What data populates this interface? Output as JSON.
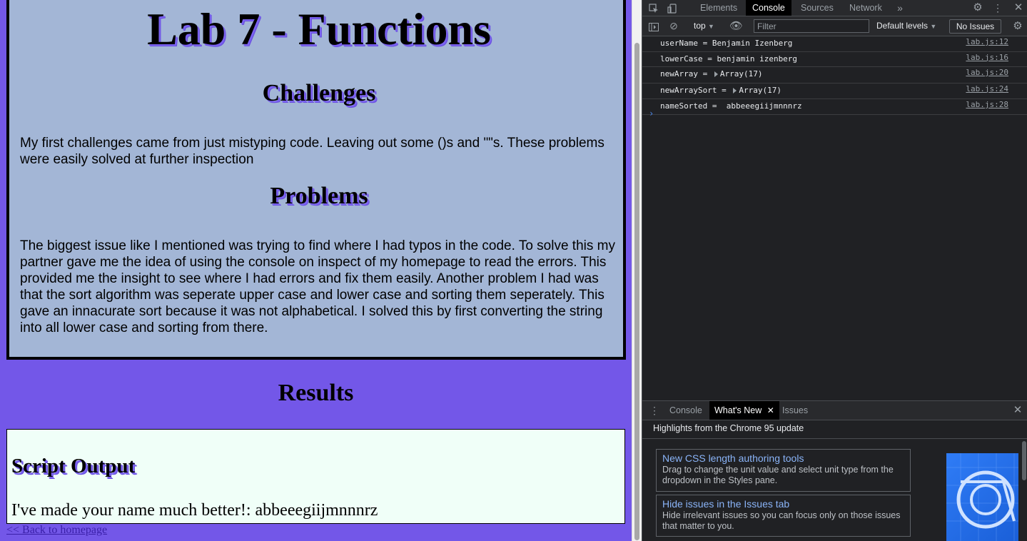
{
  "page": {
    "title": "Lab 7 - Functions",
    "challenges_heading": "Challenges",
    "challenges_text": "My first challenges came from just mistyping code. Leaving out some ()s and \"\"s. These problems were easily solved at further inspection",
    "problems_heading": "Problems",
    "problems_text": "The biggest issue like I mentioned was trying to find where I had typos in the code. To solve this my partner gave me the idea of using the console on inspect of my homepage to read the errors. This provided me the insight to see where I had errors and fix them easily. Another problem I had was that the sort algorithm was seperate upper case and lower case and sorting them seperately. This gave an innacurate sort because it was not alphabetical. I solved this by first converting the string into all lower case and sorting from there.",
    "results_heading": "Results",
    "output_heading": "Script Output",
    "output_text": "I've made your name much better!: abbeeegiijmnnnrz",
    "back_link": "<< Back to homepage"
  },
  "devtools": {
    "tabs": [
      "Elements",
      "Console",
      "Sources",
      "Network"
    ],
    "active_tab": "Console",
    "more_tabs": "»",
    "toolbar": {
      "context": "top",
      "filter_placeholder": "Filter",
      "levels": "Default levels",
      "issues": "No Issues"
    },
    "logs": [
      {
        "message": "userName = Benjamin Izenberg",
        "source": "lab.js:12"
      },
      {
        "message": "lowerCase = benjamin izenberg",
        "source": "lab.js:16"
      },
      {
        "prefix": "newArray = ",
        "object": "Array(17)",
        "source": "lab.js:20"
      },
      {
        "prefix": "newArraySort = ",
        "object": "Array(17)",
        "source": "lab.js:24"
      },
      {
        "message": "nameSorted =  abbeeegiijmnnnrz",
        "source": "lab.js:28"
      }
    ],
    "prompt": "›",
    "drawer": {
      "tabs": [
        "Console",
        "What's New",
        "Issues"
      ],
      "active_tab": "What's New",
      "highlights": "Highlights from the Chrome 95 update",
      "cards": [
        {
          "title": "New CSS length authoring tools",
          "desc": "Drag to change the unit value and select unit type from the dropdown in the Styles pane."
        },
        {
          "title": "Hide issues in the Issues tab",
          "desc": "Hide irrelevant issues so you can focus only on those issues that matter to you."
        }
      ]
    }
  },
  "colors": {
    "page_bg": "#7357e8",
    "main_box_bg": "#a3b6d6",
    "output_bg": "#f0fff8",
    "devtools_bg": "#202124",
    "link_blue": "#8ab4f8"
  }
}
